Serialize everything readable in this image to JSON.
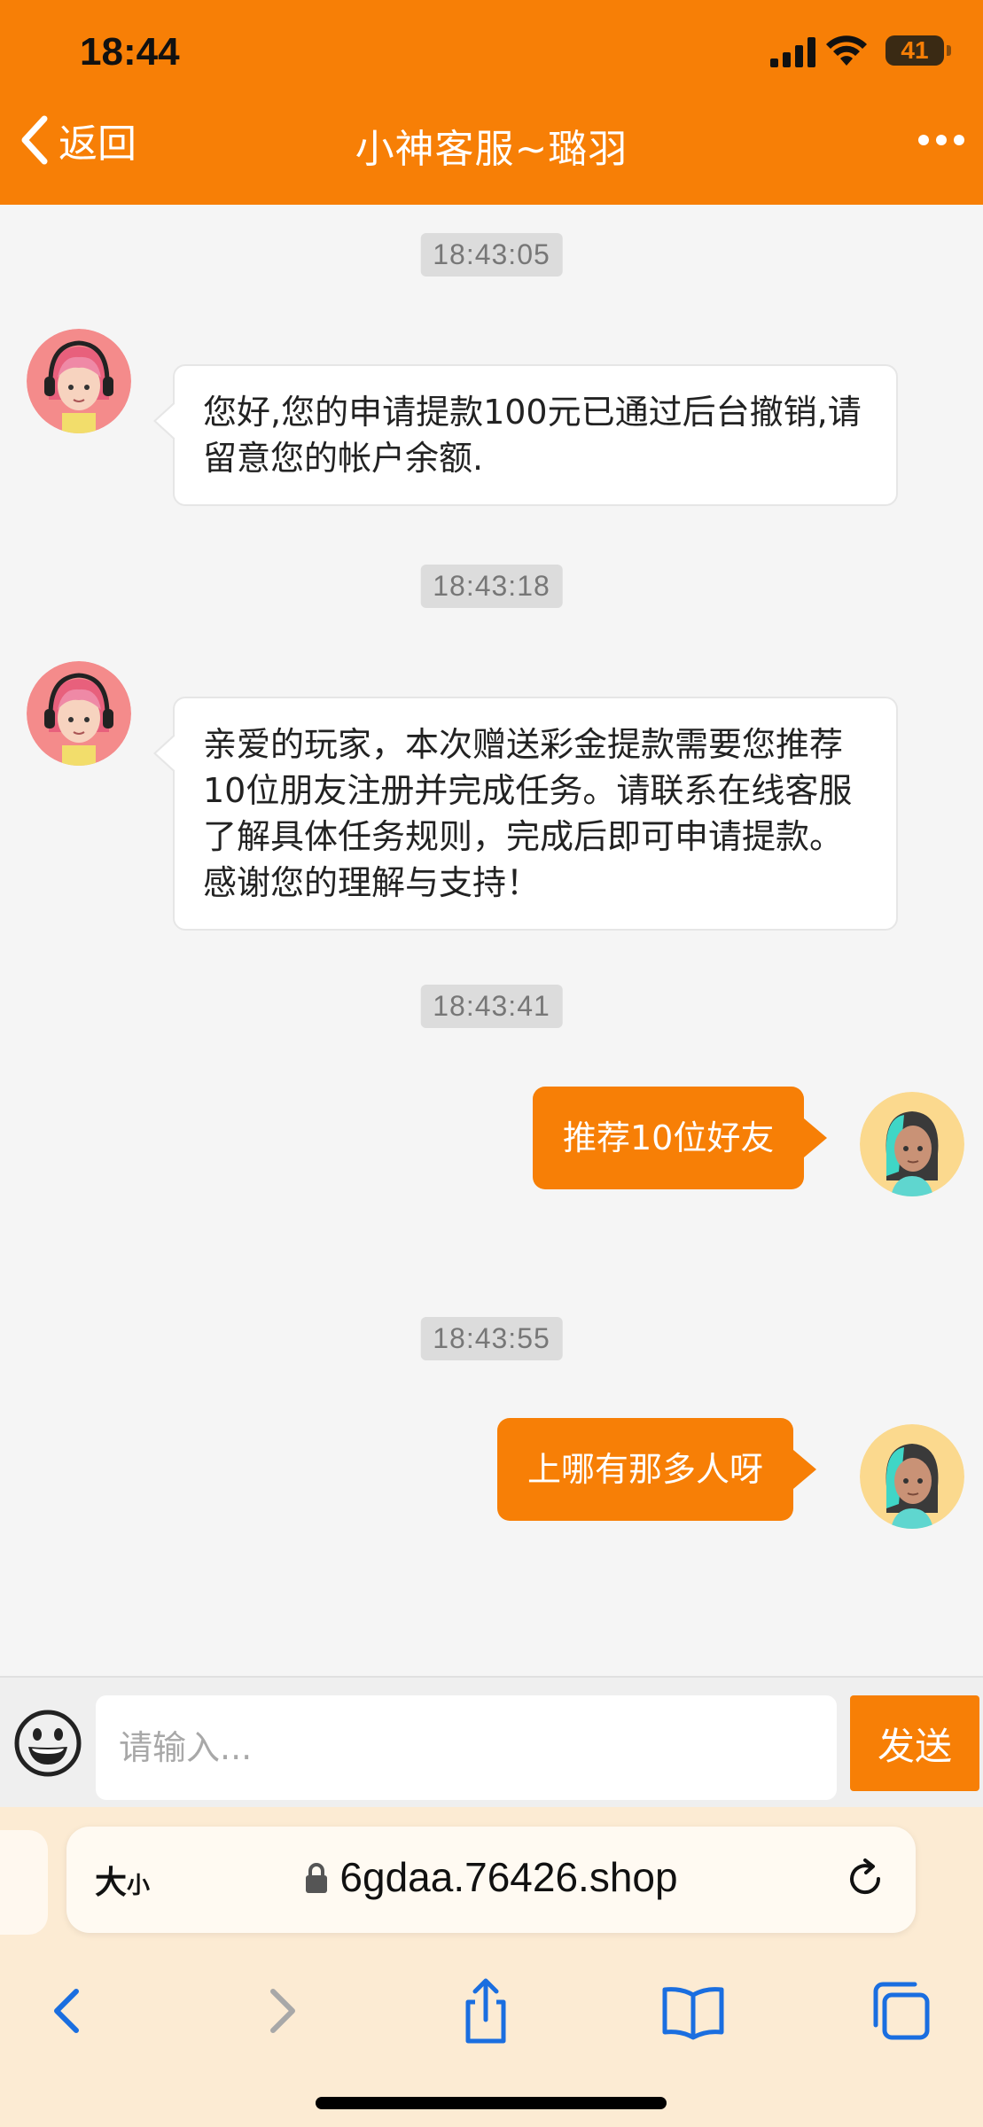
{
  "status_bar": {
    "time": "18:44",
    "battery": "41"
  },
  "header": {
    "back_label": "返回",
    "title": "小神客服~璐羽"
  },
  "messages": [
    {
      "type": "time",
      "text": "18:43:05"
    },
    {
      "type": "in",
      "text": "您好,您的申请提款100元已通过后台撤销,请留意您的帐户余额."
    },
    {
      "type": "time",
      "text": "18:43:18"
    },
    {
      "type": "in",
      "text": "亲爱的玩家，本次赠送彩金提款需要您推荐10位朋友注册并完成任务。请联系在线客服了解具体任务规则，完成后即可申请提款。感谢您的理解与支持！"
    },
    {
      "type": "time",
      "text": "18:43:41"
    },
    {
      "type": "out",
      "text": "推荐10位好友"
    },
    {
      "type": "time",
      "text": "18:43:55"
    },
    {
      "type": "out",
      "text": "上哪有那多人呀"
    }
  ],
  "input": {
    "placeholder": "请输入...",
    "send_label": "发送"
  },
  "browser": {
    "text_size_big": "大",
    "text_size_small": "小",
    "url": "6gdaa.76426.shop"
  },
  "colors": {
    "accent": "#f77f06",
    "chat_bg": "#f5f5f5"
  }
}
